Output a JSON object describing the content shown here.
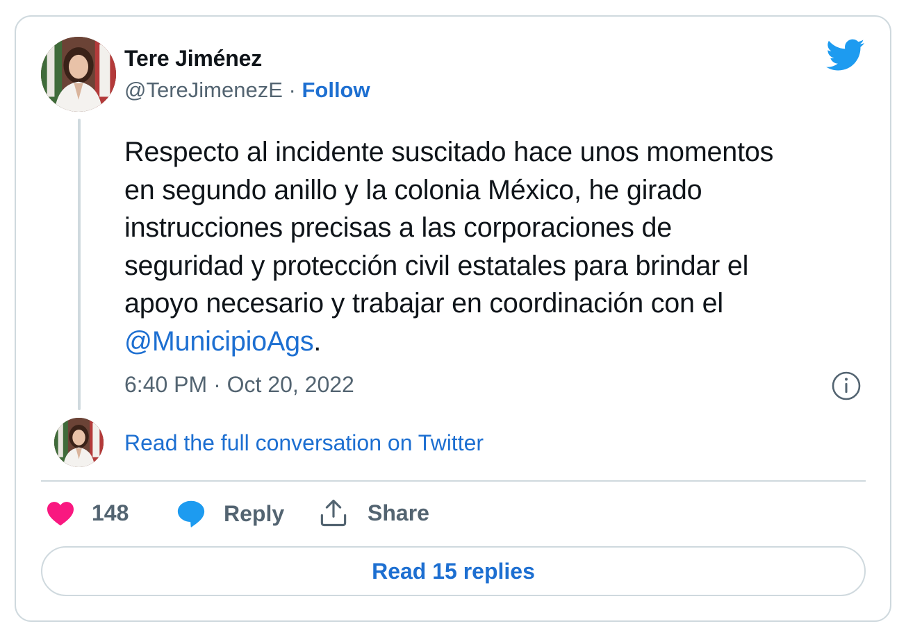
{
  "author": {
    "name": "Tere Jiménez",
    "handle": "@TereJimenezE",
    "separator": " · ",
    "follow_label": "Follow"
  },
  "tweet": {
    "text_lines": [
      "Respecto al incidente suscitado hace unos momentos",
      "en segundo anillo y la colonia México, he girado",
      "instrucciones precisas a las corporaciones de",
      "seguridad y protección civil estatales para brindar el",
      "apoyo necesario y trabajar en coordinación con el"
    ],
    "mention": "@MunicipioAgs",
    "trailing": ".",
    "timestamp": "6:40 PM · Oct 20, 2022"
  },
  "conversation": {
    "link_label": "Read the full conversation on Twitter"
  },
  "actions": {
    "like_count": "148",
    "reply_label": "Reply",
    "share_label": "Share"
  },
  "replies_button": {
    "label": "Read 15 replies"
  },
  "icons": {
    "brand": "twitter-bird-icon",
    "like": "heart-icon",
    "reply": "speech-bubble-icon",
    "share": "share-upload-icon",
    "info": "info-icon"
  },
  "colors": {
    "link": "#1d6fd1",
    "brand_blue": "#1d9bf0",
    "like_pink": "#f91880",
    "muted_text": "#536471",
    "border": "#cfd9de"
  }
}
